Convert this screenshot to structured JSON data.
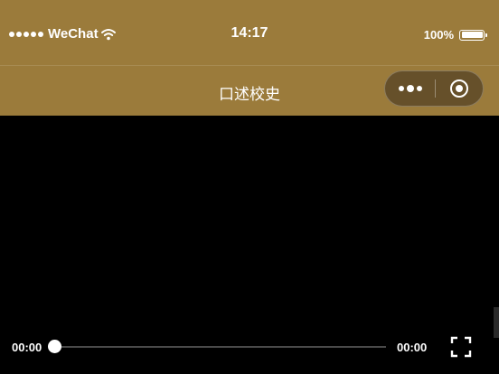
{
  "status_bar": {
    "carrier": "WeChat",
    "time": "14:17",
    "battery_percent": "100%",
    "battery_level": 1.0,
    "signal_dots": 5
  },
  "nav": {
    "title": "口述校史"
  },
  "capsule": {
    "more_icon": "more-dots-icon",
    "close_icon": "close-target-icon"
  },
  "video": {
    "current_time": "00:00",
    "duration": "00:00",
    "progress": 0,
    "fullscreen_icon": "fullscreen-icon"
  },
  "colors": {
    "brand": "#9b7b3b",
    "capsule": "#66502a",
    "background": "#000000"
  }
}
